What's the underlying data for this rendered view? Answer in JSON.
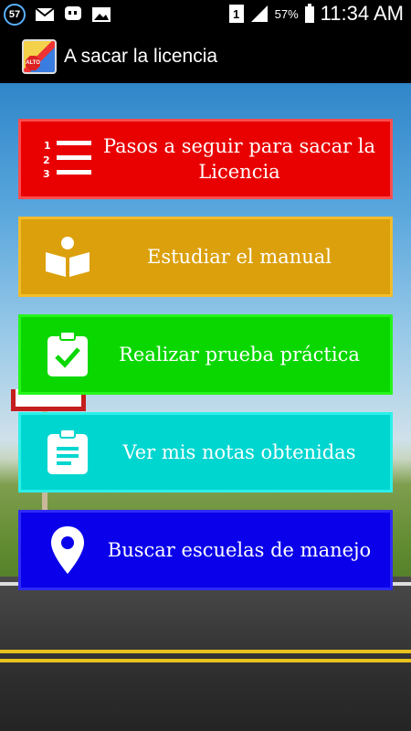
{
  "status_bar": {
    "notification_badge": "57",
    "sim_label": "1",
    "battery": "57%",
    "time": "11:34 AM"
  },
  "action_bar": {
    "app_icon_text": "ALTO",
    "title": "A sacar la licencia"
  },
  "menu": {
    "items": [
      {
        "label": "Pasos a seguir para sacar la Licencia",
        "icon": "numbered-list-icon",
        "color": "#e90000"
      },
      {
        "label": "Estudiar el manual",
        "icon": "reading-book-icon",
        "color": "#dba00c"
      },
      {
        "label": "Realizar prueba práctica",
        "icon": "clipboard-check-icon",
        "color": "#0ad700"
      },
      {
        "label": "Ver mis notas obtenidas",
        "icon": "clipboard-notes-icon",
        "color": "#00d6d0"
      },
      {
        "label": "Buscar escuelas de manejo",
        "icon": "map-pin-icon",
        "color": "#0a00e9"
      }
    ]
  }
}
